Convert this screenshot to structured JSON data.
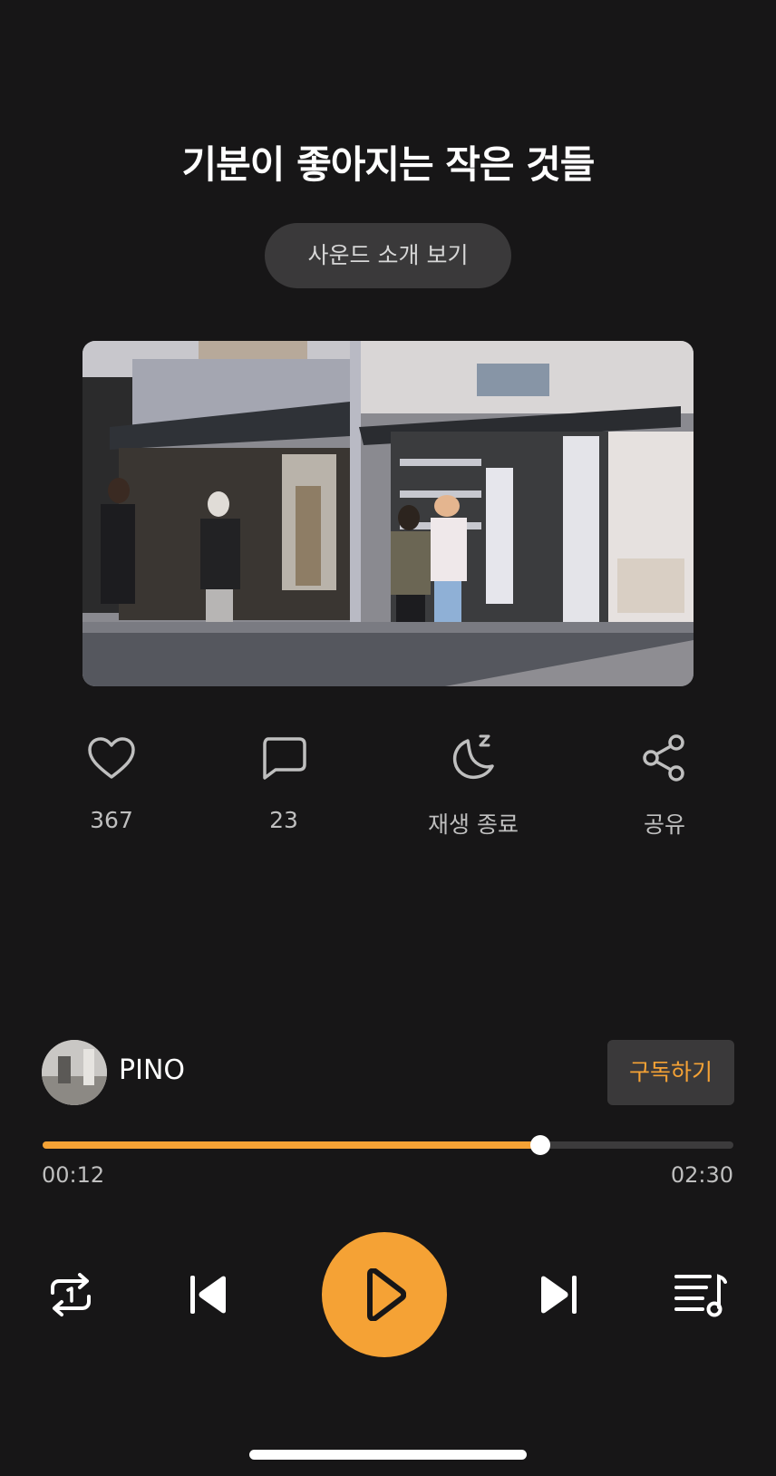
{
  "sound": {
    "title": "기분이 좋아지는 작은 것들",
    "intro_button_label": "사운드 소개 보기"
  },
  "actions": {
    "like": {
      "icon": "heart-icon",
      "label": "367"
    },
    "comment": {
      "icon": "comment-icon",
      "label": "23"
    },
    "sleep_timer": {
      "icon": "moon-sleep-icon",
      "label": "재생 종료"
    },
    "share": {
      "icon": "share-icon",
      "label": "공유"
    }
  },
  "artist": {
    "name": "PINO",
    "subscribe_label": "구독하기"
  },
  "player": {
    "current_time": "00:12",
    "total_time": "02:30",
    "progress_fraction": 0.72,
    "controls": {
      "repeat": "repeat-one-icon",
      "previous": "skip-previous-icon",
      "play": "play-icon",
      "next": "skip-next-icon",
      "playlist": "playlist-icon"
    }
  },
  "colors": {
    "background": "#171617",
    "accent": "#f5a235",
    "button_bg": "#3a393a",
    "muted_text": "#bfbfbf"
  }
}
